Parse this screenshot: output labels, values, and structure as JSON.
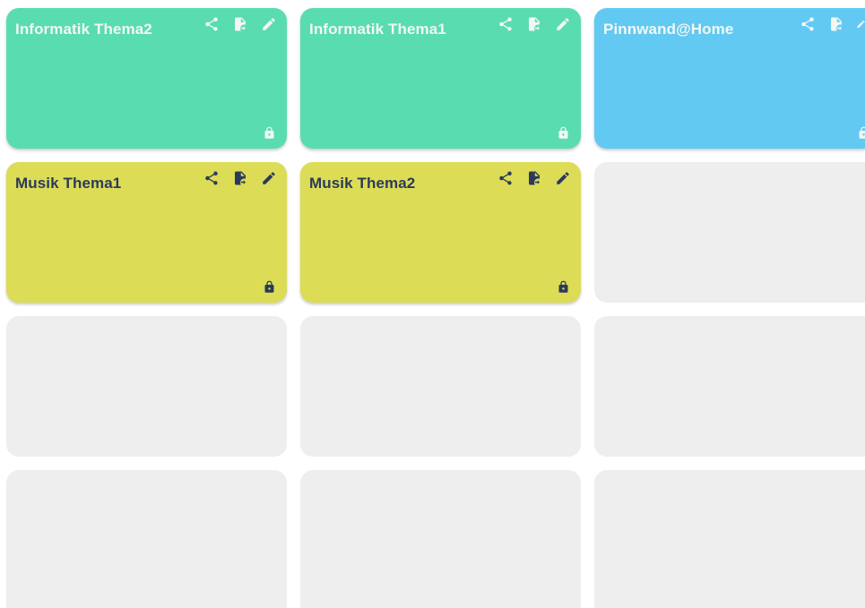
{
  "colors": {
    "green": "#59dcb0",
    "blue": "#62c9f3",
    "yellow": "#dcdc56",
    "empty": "#eeeeee",
    "light_fg": "#f2f7f4",
    "dark_fg": "#2b3a5c"
  },
  "boards": [
    {
      "title": "Informatik Thema2",
      "bg": "#59dcb0",
      "fg": "#f2f7f4",
      "icons": [
        "share-icon",
        "export-file-icon",
        "edit-pencil-icon"
      ],
      "locked": true
    },
    {
      "title": "Informatik Thema1",
      "bg": "#59dcb0",
      "fg": "#f2f7f4",
      "icons": [
        "share-icon",
        "export-file-icon",
        "edit-pencil-icon"
      ],
      "locked": true
    },
    {
      "title": "Pinnwand@Home",
      "bg": "#62c9f3",
      "fg": "#f2f7f4",
      "icons": [
        "share-icon",
        "export-file-icon",
        "edit-pencil-icon"
      ],
      "locked": true
    },
    {
      "title": "Musik Thema1",
      "bg": "#dcdc56",
      "fg": "#2b3a5c",
      "icons": [
        "share-icon",
        "export-file-icon",
        "edit-pencil-icon"
      ],
      "locked": true
    },
    {
      "title": "Musik Thema2",
      "bg": "#dcdc56",
      "fg": "#2b3a5c",
      "icons": [
        "share-icon",
        "export-file-icon",
        "edit-pencil-icon"
      ],
      "locked": true
    }
  ],
  "empty_slots": 7
}
